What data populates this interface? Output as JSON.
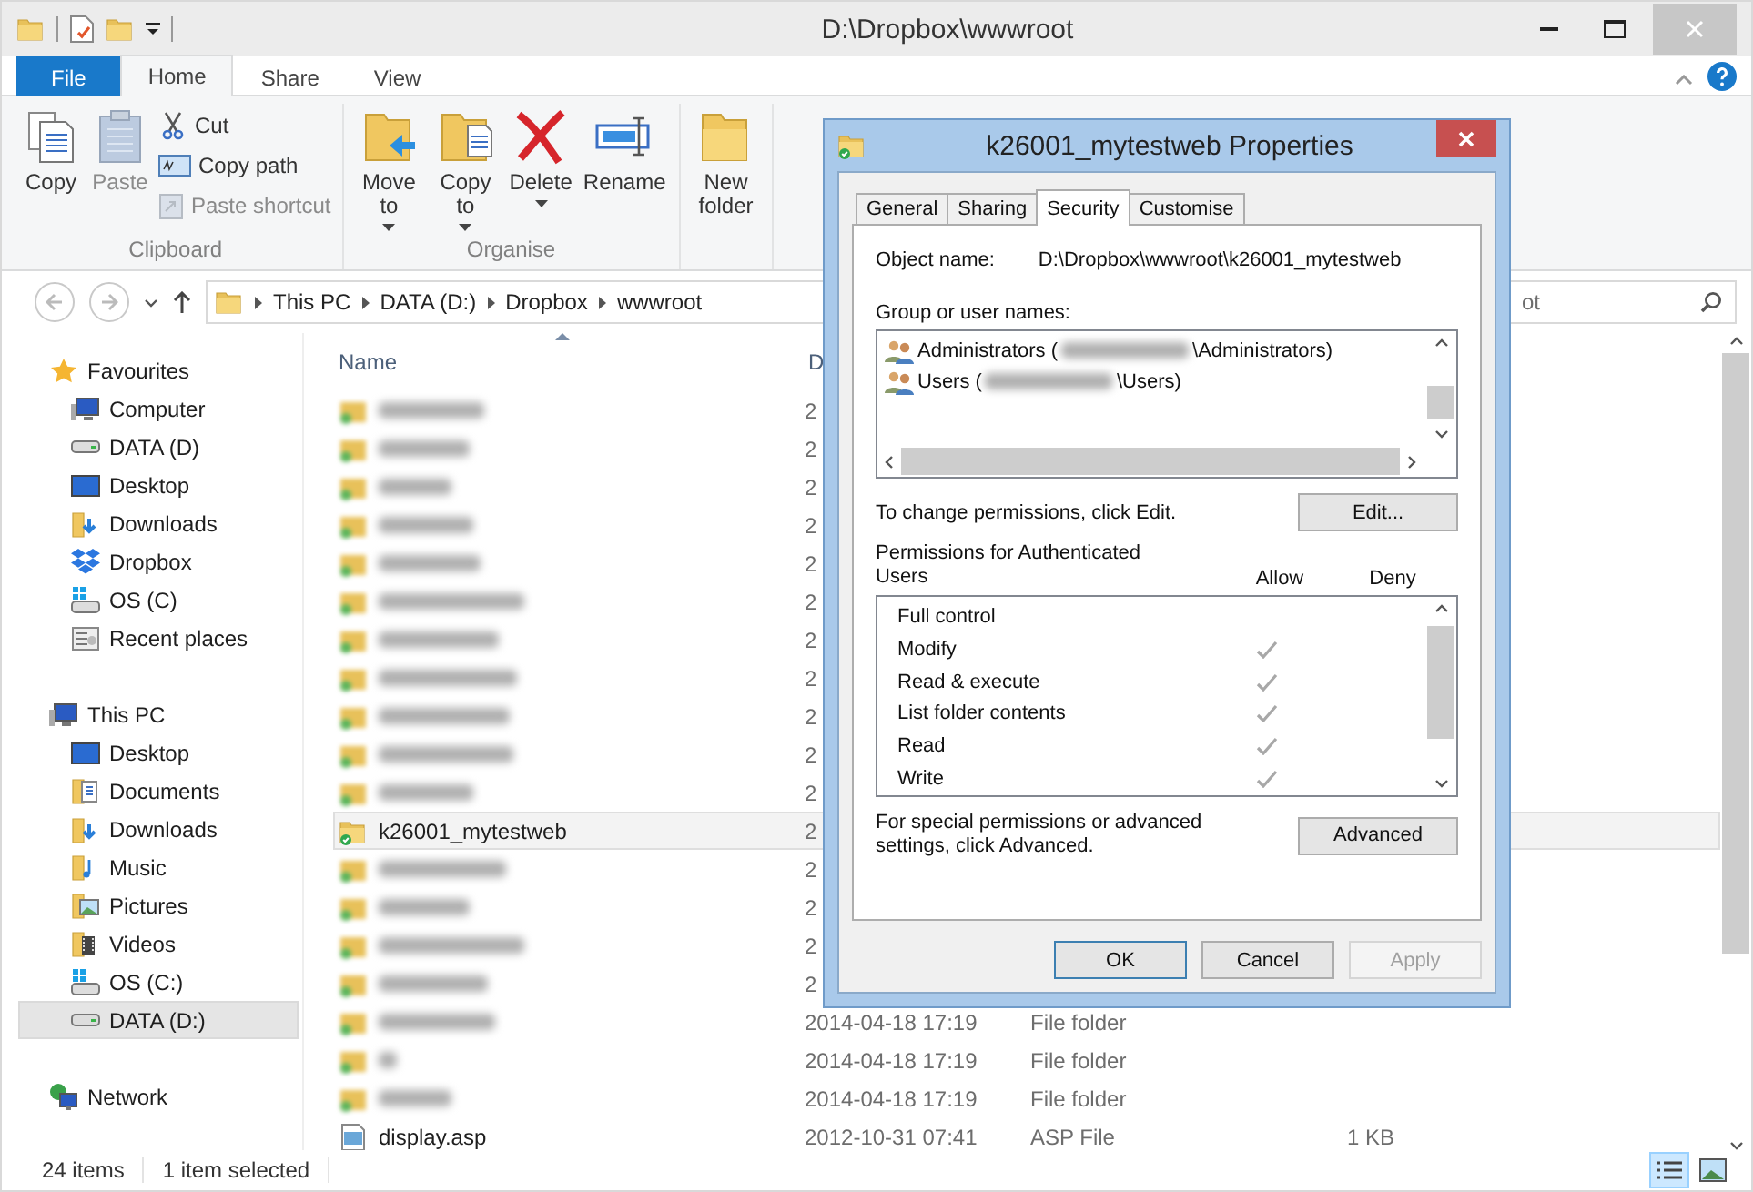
{
  "window": {
    "title": "D:\\Dropbox\\wwwroot"
  },
  "ribbon_tabs": [
    {
      "label": "File",
      "kind": "file",
      "selected": false
    },
    {
      "label": "Home",
      "kind": "tab",
      "selected": true
    },
    {
      "label": "Share",
      "kind": "tab",
      "selected": false
    },
    {
      "label": "View",
      "kind": "tab",
      "selected": false
    }
  ],
  "ribbon_groups": [
    {
      "label": "Clipboard",
      "buttons": [
        {
          "label": "Copy",
          "kind": "large",
          "disabled": false,
          "dropdown": false
        },
        {
          "label": "Paste",
          "kind": "large",
          "disabled": true,
          "dropdown": false
        },
        {
          "label": "Cut",
          "kind": "small",
          "disabled": false,
          "dropdown": false
        },
        {
          "label": "Copy path",
          "kind": "small",
          "disabled": false,
          "dropdown": false
        },
        {
          "label": "Paste shortcut",
          "kind": "small",
          "disabled": true,
          "dropdown": false
        }
      ]
    },
    {
      "label": "Organise",
      "buttons": [
        {
          "label": "Move to",
          "kind": "large",
          "disabled": false,
          "dropdown": true
        },
        {
          "label": "Copy to",
          "kind": "large",
          "disabled": false,
          "dropdown": true
        },
        {
          "label": "Delete",
          "kind": "large",
          "disabled": false,
          "dropdown": true
        },
        {
          "label": "Rename",
          "kind": "large",
          "disabled": false,
          "dropdown": false
        }
      ]
    },
    {
      "buttons": [
        {
          "label": "New folder",
          "kind": "large",
          "disabled": false,
          "dropdown": false
        }
      ]
    }
  ],
  "address": {
    "parts": [
      "This PC",
      "DATA (D:)",
      "Dropbox",
      "wwwroot"
    ]
  },
  "search": {
    "placeholder": "ot"
  },
  "nav": [
    {
      "label": "Favourites",
      "kind": "star",
      "selected": false,
      "children": [
        {
          "label": "Computer",
          "kind": "computer",
          "selected": false
        },
        {
          "label": "DATA (D)",
          "kind": "drive",
          "selected": false
        },
        {
          "label": "Desktop",
          "kind": "desktop",
          "selected": false
        },
        {
          "label": "Downloads",
          "kind": "downloads",
          "selected": false
        },
        {
          "label": "Dropbox",
          "kind": "dropbox",
          "selected": false
        },
        {
          "label": "OS (C)",
          "kind": "osdrive",
          "selected": false
        },
        {
          "label": "Recent places",
          "kind": "recent",
          "selected": false
        }
      ]
    },
    {
      "label": "This PC",
      "kind": "computer",
      "selected": false,
      "children": [
        {
          "label": "Desktop",
          "kind": "desktop",
          "selected": false
        },
        {
          "label": "Documents",
          "kind": "documents",
          "selected": false
        },
        {
          "label": "Downloads",
          "kind": "downloads",
          "selected": false
        },
        {
          "label": "Music",
          "kind": "music",
          "selected": false
        },
        {
          "label": "Pictures",
          "kind": "pictures",
          "selected": false
        },
        {
          "label": "Videos",
          "kind": "videos",
          "selected": false
        },
        {
          "label": "OS (C:)",
          "kind": "osdrive",
          "selected": false
        },
        {
          "label": "DATA (D:)",
          "kind": "drive",
          "selected": true
        }
      ]
    },
    {
      "label": "Network",
      "kind": "network",
      "selected": false
    }
  ],
  "columns": [
    {
      "label": "Name",
      "sorted": true
    },
    {
      "label": "D",
      "sorted": false
    }
  ],
  "rows": [
    {
      "kind": "folder",
      "blurred": true,
      "selected": false,
      "date": "2"
    },
    {
      "kind": "folder",
      "blurred": true,
      "selected": false,
      "date": "2"
    },
    {
      "kind": "folder",
      "blurred": true,
      "selected": false,
      "date": "2"
    },
    {
      "kind": "folder",
      "blurred": true,
      "selected": false,
      "date": "2"
    },
    {
      "kind": "folder",
      "blurred": true,
      "selected": false,
      "date": "2"
    },
    {
      "kind": "folder",
      "blurred": true,
      "selected": false,
      "date": "2"
    },
    {
      "kind": "folder",
      "blurred": true,
      "selected": false,
      "date": "2"
    },
    {
      "kind": "folder",
      "blurred": true,
      "selected": false,
      "date": "2"
    },
    {
      "kind": "folder",
      "blurred": true,
      "selected": false,
      "date": "2"
    },
    {
      "kind": "folder",
      "blurred": true,
      "selected": false,
      "date": "2"
    },
    {
      "kind": "folder",
      "blurred": true,
      "selected": false,
      "date": "2"
    },
    {
      "kind": "folder",
      "blurred": false,
      "name": "k26001_mytestweb",
      "selected": true,
      "date": "2"
    },
    {
      "kind": "folder",
      "blurred": true,
      "selected": false,
      "date": "2"
    },
    {
      "kind": "folder",
      "blurred": true,
      "selected": false,
      "date": "2"
    },
    {
      "kind": "folder",
      "blurred": true,
      "selected": false,
      "date": "2"
    },
    {
      "kind": "folder",
      "blurred": true,
      "selected": false,
      "date": "2"
    },
    {
      "kind": "folder",
      "blurred": true,
      "selected": false,
      "date": "2014-04-18 17:19",
      "type": "File folder"
    },
    {
      "kind": "folder",
      "blurred": true,
      "selected": false,
      "date": "2014-04-18 17:19",
      "type": "File folder"
    },
    {
      "kind": "folder",
      "blurred": true,
      "selected": false,
      "date": "2014-04-18 17:19",
      "type": "File folder"
    },
    {
      "kind": "file",
      "blurred": false,
      "name": "display.asp",
      "selected": false,
      "date": "2012-10-31 07:41",
      "type": "ASP File",
      "size": "1 KB"
    }
  ],
  "status_bar": {
    "count": "24 items",
    "selection": "1 item selected"
  },
  "views": [
    {
      "kind": "details",
      "selected": true
    },
    {
      "kind": "large",
      "selected": false
    }
  ],
  "dialog": {
    "title": "k26001_mytestweb Properties",
    "tabs": [
      {
        "label": "General",
        "selected": false
      },
      {
        "label": "Sharing",
        "selected": false
      },
      {
        "label": "Security",
        "selected": true
      },
      {
        "label": "Customise",
        "selected": false
      }
    ],
    "object_label": "Object name:",
    "object_value": "D:\\Dropbox\\wwwroot\\k26001_mytestweb",
    "group_label": "Group or user names:",
    "users": [
      {
        "prefix": "Administrators (",
        "suffix": "\\Administrators)"
      },
      {
        "prefix": "Users (",
        "suffix": "\\Users)"
      }
    ],
    "change_note": "To change permissions, click Edit.",
    "edit_button": "Edit...",
    "permissions_label": "Permissions for Authenticated Users",
    "allow_label": "Allow",
    "deny_label": "Deny",
    "permissions": [
      {
        "name": "Full control",
        "allow": false,
        "deny": false
      },
      {
        "name": "Modify",
        "allow": true,
        "deny": false
      },
      {
        "name": "Read & execute",
        "allow": true,
        "deny": false
      },
      {
        "name": "List folder contents",
        "allow": true,
        "deny": false
      },
      {
        "name": "Read",
        "allow": true,
        "deny": false
      },
      {
        "name": "Write",
        "allow": true,
        "deny": false
      }
    ],
    "advanced_note": "For special permissions or advanced settings, click Advanced.",
    "advanced_button": "Advanced",
    "buttons": [
      {
        "label": "OK",
        "default": true,
        "disabled": false
      },
      {
        "label": "Cancel",
        "default": false,
        "disabled": false
      },
      {
        "label": "Apply",
        "default": false,
        "disabled": true
      }
    ]
  }
}
